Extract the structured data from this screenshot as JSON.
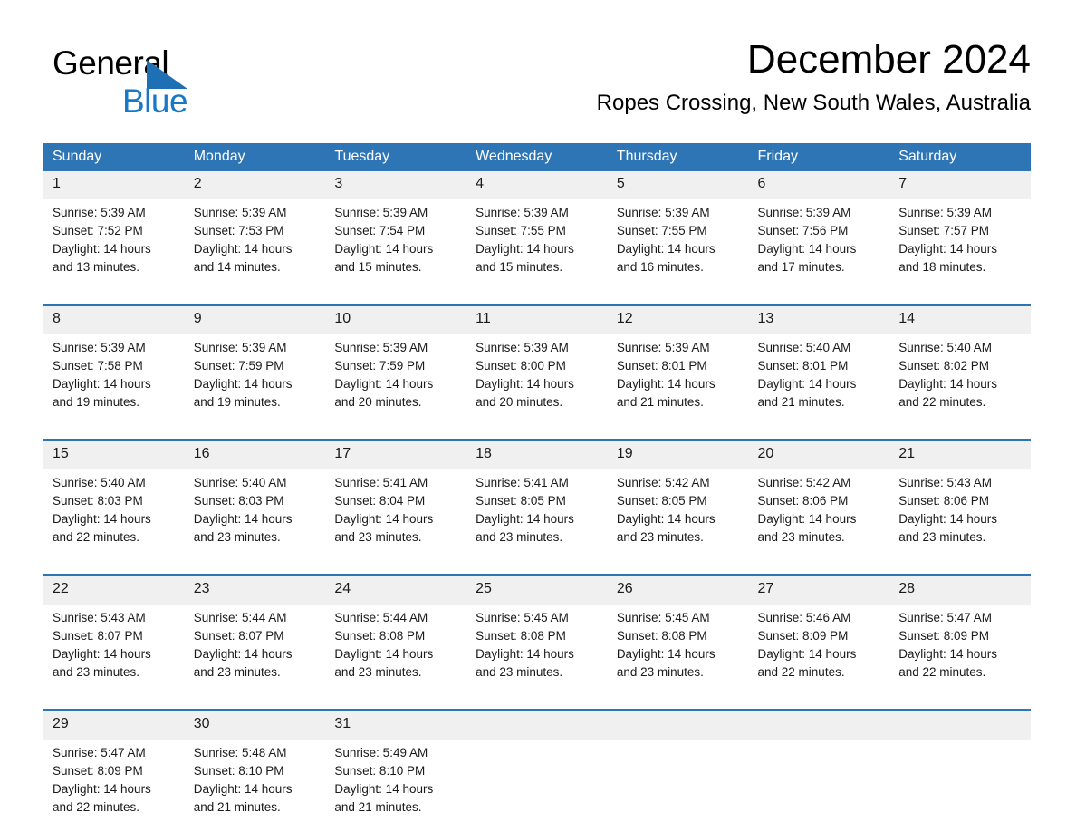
{
  "logo": {
    "word_dark": "General",
    "word_blue": "Blue",
    "triangle_color": "#1f6fb5",
    "blue_text_color": "#1878c8"
  },
  "header": {
    "title": "December 2024",
    "subtitle": "Ropes Crossing, New South Wales, Australia"
  },
  "theme": {
    "header_blue": "#2e75b6",
    "daynum_band": "#f0f0f0",
    "text": "#1a1a1a",
    "page_background": "#ffffff"
  },
  "weekday_headers": [
    "Sunday",
    "Monday",
    "Tuesday",
    "Wednesday",
    "Thursday",
    "Friday",
    "Saturday"
  ],
  "weeks": [
    {
      "days": [
        {
          "num": "1",
          "sunrise": "Sunrise: 5:39 AM",
          "sunset": "Sunset: 7:52 PM",
          "daylight1": "Daylight: 14 hours",
          "daylight2": "and 13 minutes."
        },
        {
          "num": "2",
          "sunrise": "Sunrise: 5:39 AM",
          "sunset": "Sunset: 7:53 PM",
          "daylight1": "Daylight: 14 hours",
          "daylight2": "and 14 minutes."
        },
        {
          "num": "3",
          "sunrise": "Sunrise: 5:39 AM",
          "sunset": "Sunset: 7:54 PM",
          "daylight1": "Daylight: 14 hours",
          "daylight2": "and 15 minutes."
        },
        {
          "num": "4",
          "sunrise": "Sunrise: 5:39 AM",
          "sunset": "Sunset: 7:55 PM",
          "daylight1": "Daylight: 14 hours",
          "daylight2": "and 15 minutes."
        },
        {
          "num": "5",
          "sunrise": "Sunrise: 5:39 AM",
          "sunset": "Sunset: 7:55 PM",
          "daylight1": "Daylight: 14 hours",
          "daylight2": "and 16 minutes."
        },
        {
          "num": "6",
          "sunrise": "Sunrise: 5:39 AM",
          "sunset": "Sunset: 7:56 PM",
          "daylight1": "Daylight: 14 hours",
          "daylight2": "and 17 minutes."
        },
        {
          "num": "7",
          "sunrise": "Sunrise: 5:39 AM",
          "sunset": "Sunset: 7:57 PM",
          "daylight1": "Daylight: 14 hours",
          "daylight2": "and 18 minutes."
        }
      ]
    },
    {
      "days": [
        {
          "num": "8",
          "sunrise": "Sunrise: 5:39 AM",
          "sunset": "Sunset: 7:58 PM",
          "daylight1": "Daylight: 14 hours",
          "daylight2": "and 19 minutes."
        },
        {
          "num": "9",
          "sunrise": "Sunrise: 5:39 AM",
          "sunset": "Sunset: 7:59 PM",
          "daylight1": "Daylight: 14 hours",
          "daylight2": "and 19 minutes."
        },
        {
          "num": "10",
          "sunrise": "Sunrise: 5:39 AM",
          "sunset": "Sunset: 7:59 PM",
          "daylight1": "Daylight: 14 hours",
          "daylight2": "and 20 minutes."
        },
        {
          "num": "11",
          "sunrise": "Sunrise: 5:39 AM",
          "sunset": "Sunset: 8:00 PM",
          "daylight1": "Daylight: 14 hours",
          "daylight2": "and 20 minutes."
        },
        {
          "num": "12",
          "sunrise": "Sunrise: 5:39 AM",
          "sunset": "Sunset: 8:01 PM",
          "daylight1": "Daylight: 14 hours",
          "daylight2": "and 21 minutes."
        },
        {
          "num": "13",
          "sunrise": "Sunrise: 5:40 AM",
          "sunset": "Sunset: 8:01 PM",
          "daylight1": "Daylight: 14 hours",
          "daylight2": "and 21 minutes."
        },
        {
          "num": "14",
          "sunrise": "Sunrise: 5:40 AM",
          "sunset": "Sunset: 8:02 PM",
          "daylight1": "Daylight: 14 hours",
          "daylight2": "and 22 minutes."
        }
      ]
    },
    {
      "days": [
        {
          "num": "15",
          "sunrise": "Sunrise: 5:40 AM",
          "sunset": "Sunset: 8:03 PM",
          "daylight1": "Daylight: 14 hours",
          "daylight2": "and 22 minutes."
        },
        {
          "num": "16",
          "sunrise": "Sunrise: 5:40 AM",
          "sunset": "Sunset: 8:03 PM",
          "daylight1": "Daylight: 14 hours",
          "daylight2": "and 23 minutes."
        },
        {
          "num": "17",
          "sunrise": "Sunrise: 5:41 AM",
          "sunset": "Sunset: 8:04 PM",
          "daylight1": "Daylight: 14 hours",
          "daylight2": "and 23 minutes."
        },
        {
          "num": "18",
          "sunrise": "Sunrise: 5:41 AM",
          "sunset": "Sunset: 8:05 PM",
          "daylight1": "Daylight: 14 hours",
          "daylight2": "and 23 minutes."
        },
        {
          "num": "19",
          "sunrise": "Sunrise: 5:42 AM",
          "sunset": "Sunset: 8:05 PM",
          "daylight1": "Daylight: 14 hours",
          "daylight2": "and 23 minutes."
        },
        {
          "num": "20",
          "sunrise": "Sunrise: 5:42 AM",
          "sunset": "Sunset: 8:06 PM",
          "daylight1": "Daylight: 14 hours",
          "daylight2": "and 23 minutes."
        },
        {
          "num": "21",
          "sunrise": "Sunrise: 5:43 AM",
          "sunset": "Sunset: 8:06 PM",
          "daylight1": "Daylight: 14 hours",
          "daylight2": "and 23 minutes."
        }
      ]
    },
    {
      "days": [
        {
          "num": "22",
          "sunrise": "Sunrise: 5:43 AM",
          "sunset": "Sunset: 8:07 PM",
          "daylight1": "Daylight: 14 hours",
          "daylight2": "and 23 minutes."
        },
        {
          "num": "23",
          "sunrise": "Sunrise: 5:44 AM",
          "sunset": "Sunset: 8:07 PM",
          "daylight1": "Daylight: 14 hours",
          "daylight2": "and 23 minutes."
        },
        {
          "num": "24",
          "sunrise": "Sunrise: 5:44 AM",
          "sunset": "Sunset: 8:08 PM",
          "daylight1": "Daylight: 14 hours",
          "daylight2": "and 23 minutes."
        },
        {
          "num": "25",
          "sunrise": "Sunrise: 5:45 AM",
          "sunset": "Sunset: 8:08 PM",
          "daylight1": "Daylight: 14 hours",
          "daylight2": "and 23 minutes."
        },
        {
          "num": "26",
          "sunrise": "Sunrise: 5:45 AM",
          "sunset": "Sunset: 8:08 PM",
          "daylight1": "Daylight: 14 hours",
          "daylight2": "and 23 minutes."
        },
        {
          "num": "27",
          "sunrise": "Sunrise: 5:46 AM",
          "sunset": "Sunset: 8:09 PM",
          "daylight1": "Daylight: 14 hours",
          "daylight2": "and 22 minutes."
        },
        {
          "num": "28",
          "sunrise": "Sunrise: 5:47 AM",
          "sunset": "Sunset: 8:09 PM",
          "daylight1": "Daylight: 14 hours",
          "daylight2": "and 22 minutes."
        }
      ]
    },
    {
      "days": [
        {
          "num": "29",
          "sunrise": "Sunrise: 5:47 AM",
          "sunset": "Sunset: 8:09 PM",
          "daylight1": "Daylight: 14 hours",
          "daylight2": "and 22 minutes."
        },
        {
          "num": "30",
          "sunrise": "Sunrise: 5:48 AM",
          "sunset": "Sunset: 8:10 PM",
          "daylight1": "Daylight: 14 hours",
          "daylight2": "and 21 minutes."
        },
        {
          "num": "31",
          "sunrise": "Sunrise: 5:49 AM",
          "sunset": "Sunset: 8:10 PM",
          "daylight1": "Daylight: 14 hours",
          "daylight2": "and 21 minutes."
        },
        {
          "num": "",
          "sunrise": "",
          "sunset": "",
          "daylight1": "",
          "daylight2": ""
        },
        {
          "num": "",
          "sunrise": "",
          "sunset": "",
          "daylight1": "",
          "daylight2": ""
        },
        {
          "num": "",
          "sunrise": "",
          "sunset": "",
          "daylight1": "",
          "daylight2": ""
        },
        {
          "num": "",
          "sunrise": "",
          "sunset": "",
          "daylight1": "",
          "daylight2": ""
        }
      ]
    }
  ]
}
